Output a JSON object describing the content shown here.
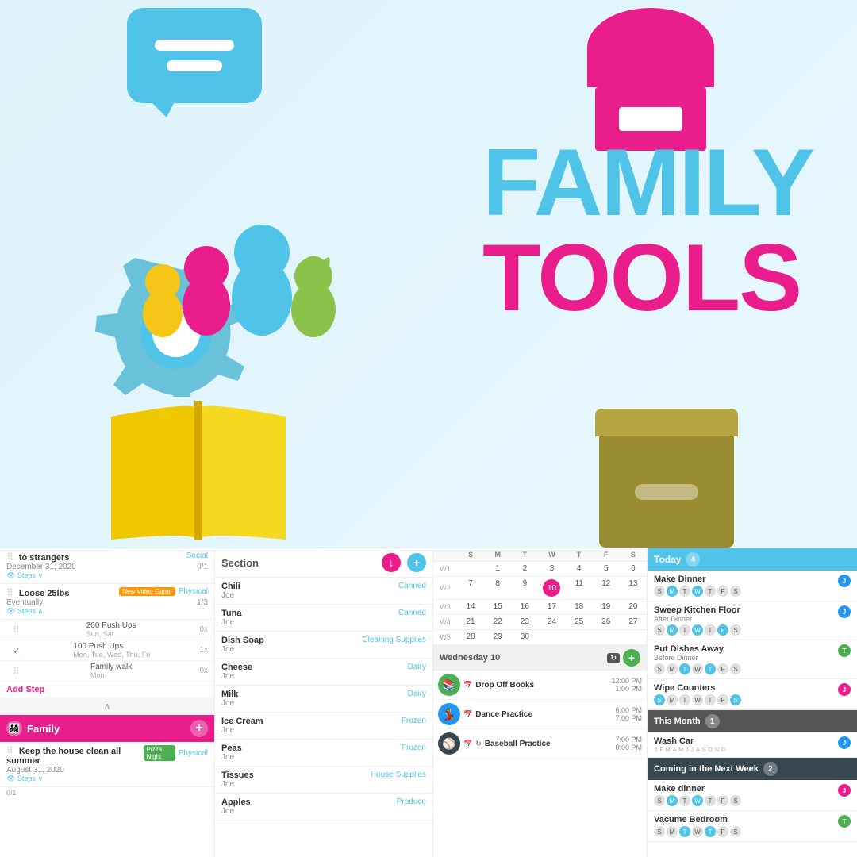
{
  "app": {
    "title": "Family Tools",
    "title_family": "FAMILY",
    "title_tools": "TOOLS"
  },
  "goals_panel": {
    "items": [
      {
        "title": "to strangers",
        "subtitle": "December 31, 2020",
        "type": "Social",
        "steps_label": "Steps",
        "progress": "0/1"
      },
      {
        "title": "Loose 25lbs",
        "subtitle": "Eventually",
        "type": "Physical",
        "badge": "New Video Game",
        "steps_label": "Steps",
        "progress": "1/3"
      }
    ],
    "steps": [
      {
        "name": "200 Push Ups",
        "sub": "Sun, Sat",
        "count": "0x",
        "checked": false
      },
      {
        "name": "100 Push Ups",
        "sub": "Mon, Tue, Wed, Thu, Fri",
        "count": "1x",
        "checked": true
      },
      {
        "name": "Family walk",
        "sub": "Mon",
        "count": "0x",
        "checked": false
      }
    ],
    "add_step": "Add Step",
    "family_section": "Family",
    "family_goal": {
      "title": "Keep the house clean all summer",
      "subtitle": "August 31, 2020",
      "type": "Physical",
      "badge": "Pizza Night",
      "steps_label": "Steps",
      "progress": "0/1"
    }
  },
  "shopping_panel": {
    "section_label": "Section",
    "items": [
      {
        "name": "Chili",
        "person": "Joe",
        "category": "Canned"
      },
      {
        "name": "Tuna",
        "person": "Joe",
        "category": "Canned"
      },
      {
        "name": "Dish Soap",
        "person": "Joe",
        "category": "Cleaning Supplies"
      },
      {
        "name": "Cheese",
        "person": "Joe",
        "category": "Dairy"
      },
      {
        "name": "Milk",
        "person": "Joe",
        "category": "Dairy"
      },
      {
        "name": "Ice Cream",
        "person": "Joe",
        "category": "Frozen"
      },
      {
        "name": "Peas",
        "person": "Joe",
        "category": "Frozen"
      },
      {
        "name": "Tissues",
        "person": "Joe",
        "category": "House Supplies"
      },
      {
        "name": "Apples",
        "person": "Joe",
        "category": "Produce"
      }
    ]
  },
  "calendar": {
    "weeks": [
      "W1",
      "W2",
      "W3",
      "W4",
      "W5"
    ],
    "days_header": [
      "S",
      "M",
      "T",
      "W",
      "T",
      "F",
      "S"
    ],
    "rows": [
      {
        "week": "W1",
        "days": [
          "",
          "",
          "1",
          "2",
          "3",
          "4",
          "5",
          "6"
        ]
      },
      {
        "week": "W2",
        "days": [
          "",
          "7",
          "8",
          "9",
          "10",
          "11",
          "12",
          "13"
        ]
      },
      {
        "week": "W3",
        "days": [
          "",
          "14",
          "15",
          "16",
          "17",
          "18",
          "19",
          "20"
        ]
      },
      {
        "week": "W4",
        "days": [
          "",
          "21",
          "22",
          "23",
          "24",
          "25",
          "26",
          "27"
        ]
      },
      {
        "week": "W5",
        "days": [
          "",
          "28",
          "29",
          "30",
          "",
          "",
          "",
          ""
        ]
      }
    ],
    "selected_day": "10",
    "day_detail_label": "Wednesday 10",
    "events": [
      {
        "name": "Drop Off Books",
        "start": "12:00 PM",
        "end": "1:00 PM",
        "color": "green",
        "icon": "📚"
      },
      {
        "name": "Dance Practice",
        "start": "6:00 PM",
        "end": "7:00 PM",
        "color": "blue",
        "icon": "💃"
      },
      {
        "name": "Baseball Practice",
        "start": "7:00 PM",
        "end": "8:00 PM",
        "color": "dark",
        "icon": "⚾",
        "recurring": true
      }
    ]
  },
  "tasks_panel": {
    "today_label": "Today",
    "today_count": "4",
    "today_tasks": [
      {
        "name": "Make Dinner",
        "days": [
          "S",
          "M",
          "T",
          "W",
          "T",
          "F",
          "S"
        ],
        "active_days": [
          1,
          3
        ],
        "avatar": "Joe",
        "avatar_color": "blue"
      },
      {
        "name": "Sweep Kitchen Floor",
        "sub": "After Dinner",
        "days": [
          "S",
          "M",
          "T",
          "W",
          "T",
          "F",
          "S"
        ],
        "active_days": [
          1,
          3,
          5
        ],
        "avatar": "Joe",
        "avatar_color": "blue"
      },
      {
        "name": "Put Dishes Away",
        "sub": "Before Dinner",
        "days": [
          "S",
          "M",
          "T",
          "W",
          "T",
          "F",
          "S"
        ],
        "active_days": [
          2,
          4
        ],
        "avatar": "Tim",
        "avatar_color": "green"
      },
      {
        "name": "Wipe Counters",
        "days": [
          "S",
          "M",
          "T",
          "W",
          "T",
          "F",
          "S"
        ],
        "active_days": [
          0,
          6
        ],
        "avatar": "Jane",
        "avatar_color": "pink"
      }
    ],
    "this_month_label": "This Month",
    "this_month_count": "1",
    "this_month_tasks": [
      {
        "name": "Wash Car",
        "months": "JFMAMJJASOND",
        "avatar": "Joe",
        "avatar_color": "blue"
      }
    ],
    "coming_label": "Coming in the Next Week",
    "coming_count": "2",
    "coming_tasks": [
      {
        "name": "Make dinner",
        "days": [
          "S",
          "M",
          "T",
          "W",
          "T",
          "F",
          "S"
        ],
        "active_days": [
          1,
          3
        ],
        "avatar": "Jane",
        "avatar_color": "pink"
      },
      {
        "name": "Vacume Bedroom",
        "days": [
          "S",
          "M",
          "T",
          "W",
          "T",
          "F",
          "S"
        ],
        "active_days": [
          2,
          4
        ],
        "avatar": "Tim",
        "avatar_color": "green"
      }
    ]
  }
}
